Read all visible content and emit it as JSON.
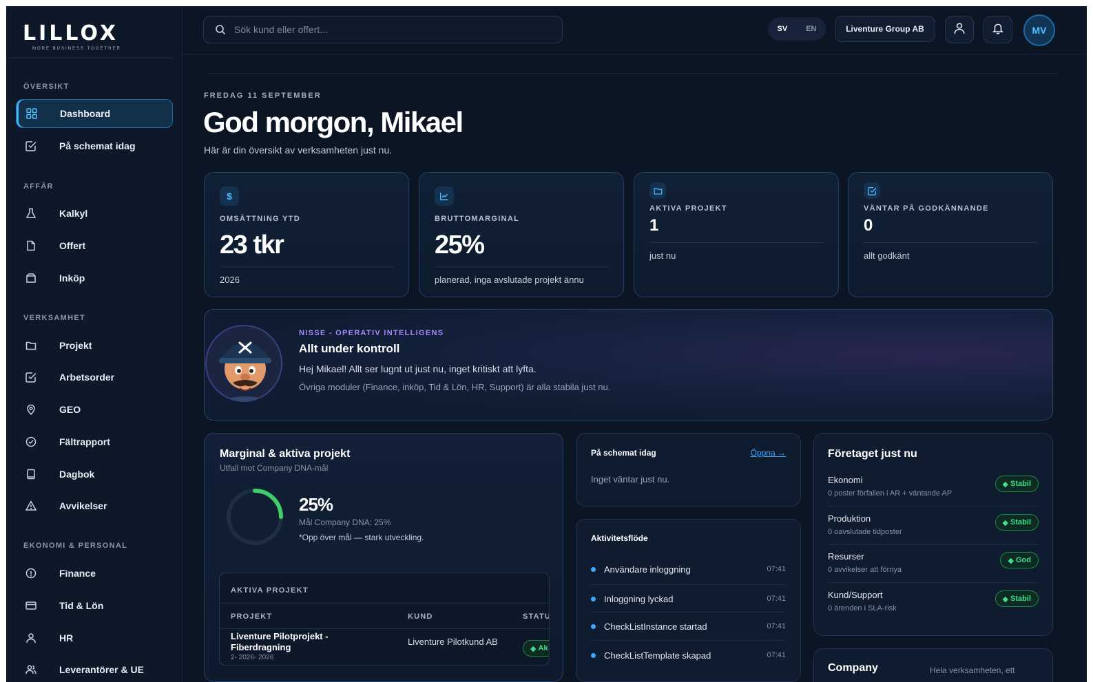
{
  "brand": {
    "name": "LILLOX",
    "tagline": "MORE BUSINESS TOGETHER"
  },
  "sidebar": {
    "sections": [
      {
        "title": "ÖVERSIKT",
        "items": [
          {
            "label": "Dashboard",
            "icon": "grid-icon",
            "active": true
          },
          {
            "label": "På schemat idag",
            "icon": "checkbox-icon"
          }
        ]
      },
      {
        "title": "AFFÄR",
        "items": [
          {
            "label": "Kalkyl",
            "icon": "flask-icon"
          },
          {
            "label": "Offert",
            "icon": "document-icon"
          },
          {
            "label": "Inköp",
            "icon": "bag-icon"
          }
        ]
      },
      {
        "title": "VERKSAMHET",
        "items": [
          {
            "label": "Projekt",
            "icon": "folder-icon"
          },
          {
            "label": "Arbetsorder",
            "icon": "checkbox-icon"
          },
          {
            "label": "GEO",
            "icon": "map-pin-icon"
          },
          {
            "label": "Fältrapport",
            "icon": "check-circle-icon"
          },
          {
            "label": "Dagbok",
            "icon": "book-icon"
          },
          {
            "label": "Avvikelser",
            "icon": "warning-icon"
          }
        ]
      },
      {
        "title": "EKONOMI & PERSONAL",
        "items": [
          {
            "label": "Finance",
            "icon": "info-circle-icon"
          },
          {
            "label": "Tid & Lön",
            "icon": "card-icon"
          },
          {
            "label": "HR",
            "icon": "user-icon"
          },
          {
            "label": "Leverantörer & UE",
            "icon": "users-icon"
          }
        ]
      }
    ]
  },
  "topbar": {
    "search_placeholder": "Sök kund eller offert...",
    "lang_active": "SV",
    "lang_other": "EN",
    "company": "Liventure Group AB",
    "avatar_initials": "MV"
  },
  "header": {
    "date": "FREDAG 11 SEPTEMBER",
    "greeting": "God morgon, Mikael",
    "subtitle": "Här är din översikt av verksamheten just nu."
  },
  "kpis": [
    {
      "label": "OMSÄTTNING YTD",
      "value": "23 tkr",
      "foot": "2026",
      "icon_glyph": "$",
      "icon": "dollar-icon"
    },
    {
      "label": "BRUTTOMARGINAL",
      "value": "25%",
      "foot": "planerad, inga avslutade projekt ännu",
      "icon": "chart-icon"
    },
    {
      "label": "AKTIVA PROJEKT",
      "value": "1",
      "foot": "just nu",
      "icon": "folder-icon"
    },
    {
      "label": "VÄNTAR PÅ GODKÄNNANDE",
      "value": "0",
      "foot": "allt godkänt",
      "icon": "edit-check-icon"
    }
  ],
  "nisse": {
    "tag": "NISSE - OPERATIV INTELLIGENS",
    "title": "Allt under kontroll",
    "line1": "Hej Mikael! Allt ser lugnt ut just nu, inget kritiskt att lyfta.",
    "line2": "Övriga moduler (Finance, inköp, Tid & Lön, HR, Support) är alla stabila just nu."
  },
  "margin_card": {
    "title": "Marginal & aktiva projekt",
    "subtitle": "Utfall mot Company DNA-mål",
    "percent": "25%",
    "progress": 0.25,
    "goal": "Mål Company DNA: 25%",
    "note": "*Opp över mål — stark utveckling.",
    "projects_title": "AKTIVA PROJEKT",
    "columns": [
      "PROJEKT",
      "KUND",
      "STATU"
    ],
    "row": {
      "name": "Liventure Pilotprojekt - Fiberdragning",
      "date": "2- 2026- 2026",
      "customer": "Liventure Pilotkund AB",
      "status": "Ak"
    }
  },
  "schedule": {
    "title": "På schemat idag",
    "link": "Öppna →",
    "empty": "Inget väntar just nu."
  },
  "activity": {
    "title": "Aktivitetsflöde",
    "items": [
      {
        "text": "Användare inloggning",
        "time": "07:41"
      },
      {
        "text": "Inloggning lyckad",
        "time": "07:41"
      },
      {
        "text": "CheckListInstance startad",
        "time": "07:41"
      },
      {
        "text": "CheckListTemplate skapad",
        "time": "07:41"
      }
    ]
  },
  "company_now": {
    "title": "Företaget just nu",
    "rows": [
      {
        "title": "Ekonomi",
        "sub": "0 poster förfallen i AR + väntande AP",
        "badge": "Stabil"
      },
      {
        "title": "Produktion",
        "sub": "0 oavslutade tidposter",
        "badge": "Stabil"
      },
      {
        "title": "Resurser",
        "sub": "0 avvikelser att förnya",
        "badge": "God"
      },
      {
        "title": "Kund/Support",
        "sub": "0 ärenden i SLA-risk",
        "badge": "Stabil"
      }
    ]
  },
  "company_card": {
    "title": "Company",
    "subtitle": "Hela verksamheten, ett"
  },
  "colors": {
    "accent": "#3fb4ff",
    "success": "#3ee08a",
    "ai": "#a58bff",
    "bg": "#0b1524"
  }
}
